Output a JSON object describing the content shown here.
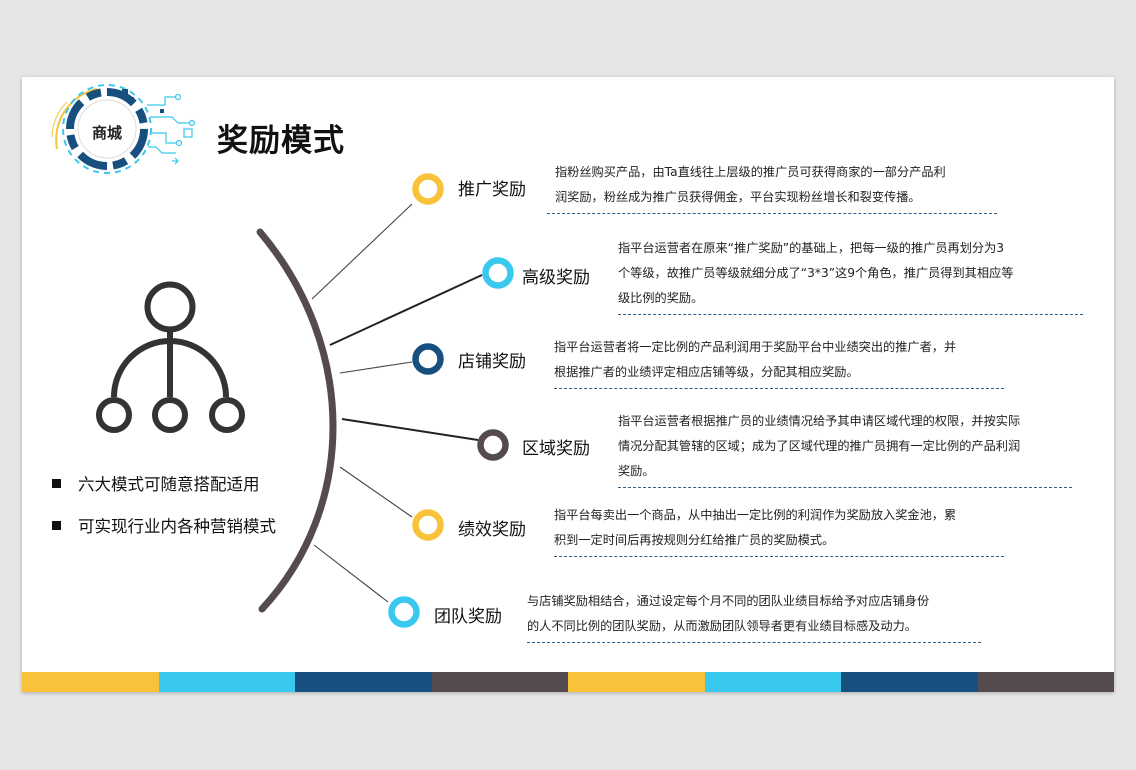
{
  "logo": {
    "text": "商城"
  },
  "title": "奖励模式",
  "colors": {
    "yellow": "#f8c23a",
    "cyan": "#39c9ee",
    "navy": "#17507f",
    "dark": "#554b4e"
  },
  "items": [
    {
      "label": "推广奖励",
      "color": "yellow",
      "lines": [
        "指粉丝购买产品，由Ta直线往上层级的推广员可获得商家的一部分产品利",
        "润奖励，粉丝成为推广员获得佣金，平台实现粉丝增长和裂变传播。"
      ]
    },
    {
      "label": "高级奖励",
      "color": "cyan",
      "lines": [
        "指平台运营者在原来“推广奖励”的基础上，把每一级的推广员再划分为3",
        "个等级，故推广员等级就细分成了“3*3”这9个角色，推广员得到其相应等",
        "级比例的奖励。"
      ]
    },
    {
      "label": "店铺奖励",
      "color": "navy",
      "lines": [
        "指平台运营者将一定比例的产品利润用于奖励平台中业绩突出的推广者，并",
        "根据推广者的业绩评定相应店铺等级，分配其相应奖励。"
      ]
    },
    {
      "label": "区域奖励",
      "color": "dark",
      "lines": [
        "指平台运营者根据推广员的业绩情况给予其申请区域代理的权限，并按实际",
        "情况分配其管辖的区域；成为了区域代理的推广员拥有一定比例的产品利润",
        "奖励。"
      ]
    },
    {
      "label": "绩效奖励",
      "color": "yellow",
      "lines": [
        "指平台每卖出一个商品，从中抽出一定比例的利润作为奖励放入奖金池，累",
        "积到一定时间后再按规则分红给推广员的奖励模式。"
      ]
    },
    {
      "label": "团队奖励",
      "color": "cyan",
      "lines": [
        "与店铺奖励相结合，通过设定每个月不同的团队业绩目标给予对应店铺身份",
        "的人不同比例的团队奖励，从而激励团队领导者更有业绩目标感及动力。"
      ]
    }
  ],
  "bullets": [
    "六大模式可随意搭配适用",
    "可实现行业内各种营销模式"
  ],
  "icons": {
    "hierarchy": "org-chart-icon",
    "logo": "circuit-badge-icon"
  }
}
